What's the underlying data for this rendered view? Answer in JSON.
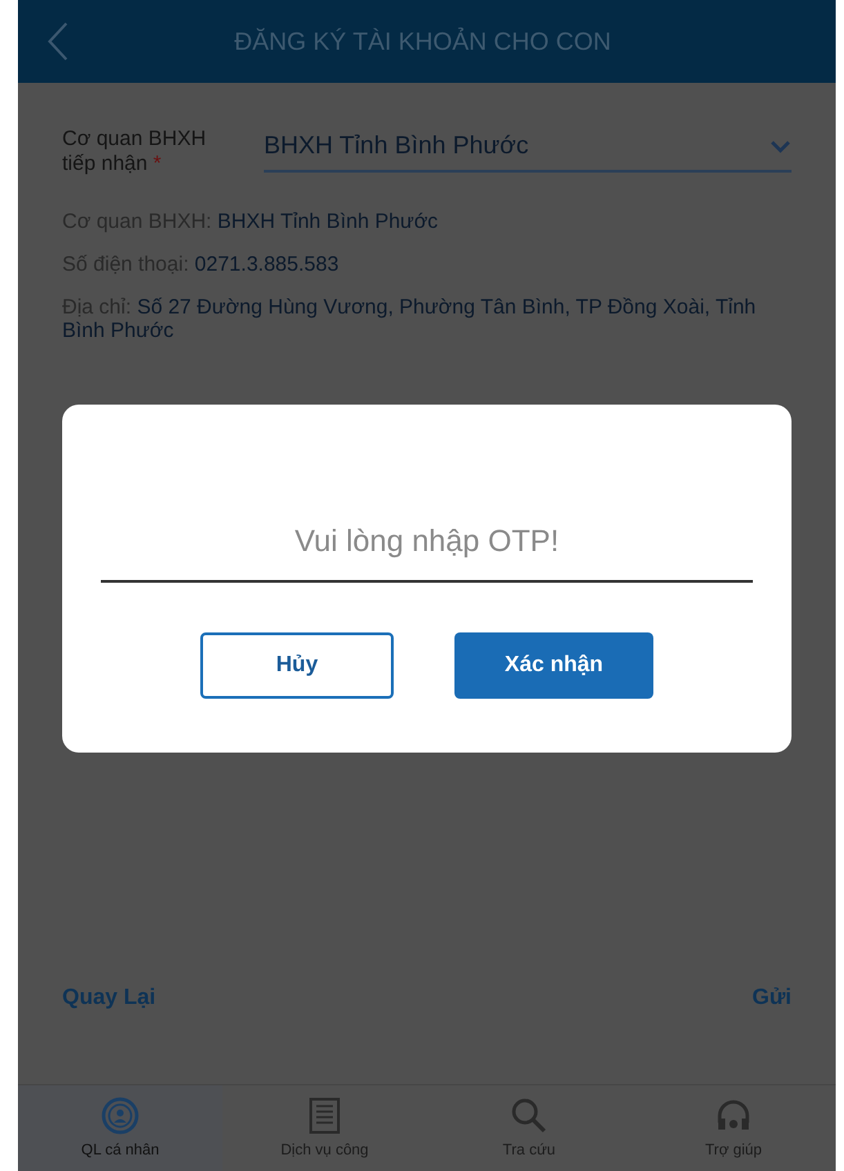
{
  "header": {
    "title": "ĐĂNG KÝ TÀI KHOẢN CHO CON"
  },
  "agency_field": {
    "label": "Cơ quan BHXH tiếp nhận",
    "required_mark": "*",
    "value": "BHXH Tỉnh Bình Phước"
  },
  "info": [
    {
      "label": "Cơ quan BHXH: ",
      "value": "BHXH Tỉnh Bình Phước"
    },
    {
      "label": "Số điện thoại: ",
      "value": "0271.3.885.583"
    },
    {
      "label": "Địa chỉ: ",
      "value": "Số 27 Đường Hùng Vương, Phường Tân Bình, TP Đồng Xoài, Tỉnh Bình Phước"
    }
  ],
  "actions": {
    "back": "Quay Lại",
    "submit": "Gửi"
  },
  "dialog": {
    "placeholder": "Vui lòng nhập OTP!",
    "cancel": "Hủy",
    "confirm": "Xác nhận"
  },
  "bottom_nav": [
    {
      "label": "QL cá nhân",
      "kind": "person",
      "selected": true
    },
    {
      "label": "Dịch vụ công",
      "kind": "document",
      "selected": false
    },
    {
      "label": "Tra cứu",
      "kind": "search",
      "selected": false
    },
    {
      "label": "Trợ giúp",
      "kind": "headset",
      "selected": false
    }
  ]
}
